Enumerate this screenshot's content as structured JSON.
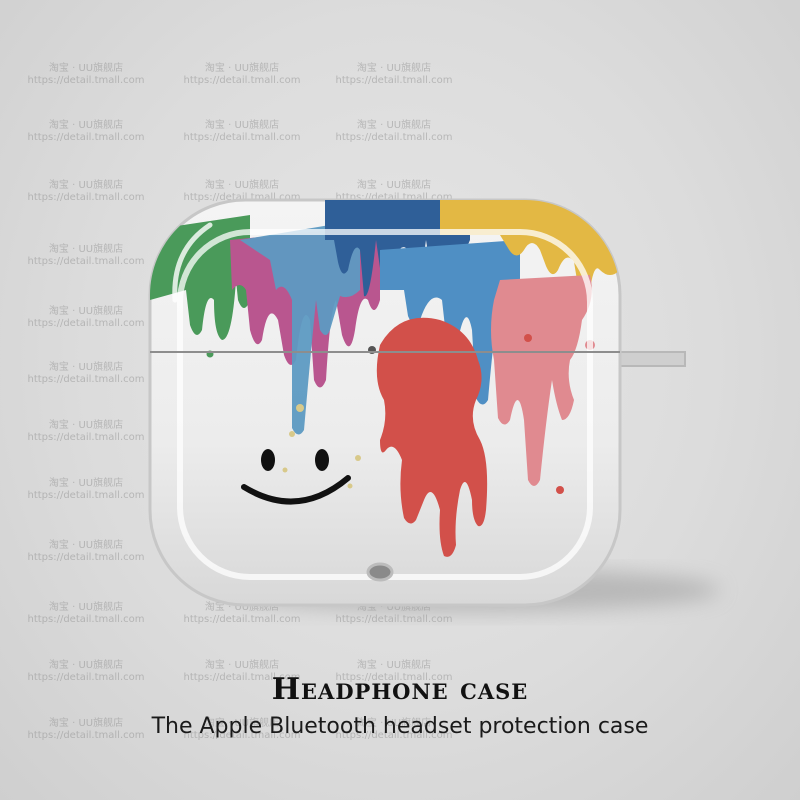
{
  "watermark": {
    "line1": "淘宝 · UU旗舰店",
    "line2": "https://detail.tmall.com"
  },
  "product": {
    "name": "headphone-case-illustration"
  },
  "caption": {
    "title": "Headphone case",
    "subtitle": "The Apple Bluetooth headset protection case"
  }
}
